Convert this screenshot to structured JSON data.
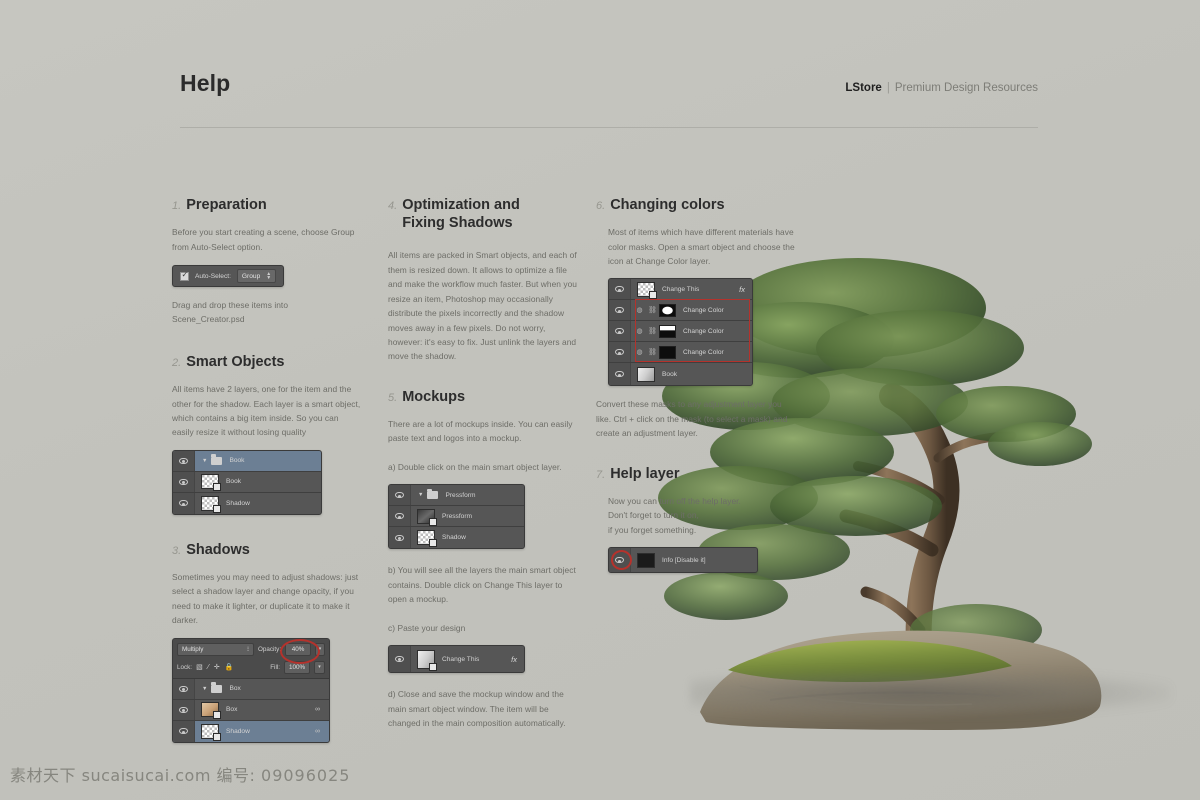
{
  "header": {
    "title": "Help",
    "brand_store": "LStore",
    "brand_separator": "|",
    "brand_tagline": "Premium Design Resources"
  },
  "columns": {
    "col1": [
      {
        "num": "1.",
        "title": "Preparation",
        "body": [
          "Before you start creating a scene, choose Group from Auto-Select option."
        ],
        "widget": {
          "type": "toolbar",
          "checkbox_label": "Auto-Select:",
          "select_value": "Group"
        },
        "body_after": [
          "Drag and drop these items into Scene_Creator.psd"
        ]
      },
      {
        "num": "2.",
        "title": "Smart Objects",
        "body": [
          "All items have 2 layers, one for the item and the other for the shadow. Each layer is a smart object, which contains a big item inside. So you can easily resize it without losing quality"
        ],
        "widget": {
          "type": "layers",
          "rows": [
            {
              "label": "Book",
              "kind": "group",
              "selected": true
            },
            {
              "label": "Book",
              "kind": "smart"
            },
            {
              "label": "Shadow",
              "kind": "smart"
            }
          ]
        }
      },
      {
        "num": "3.",
        "title": "Shadows",
        "body": [
          "Sometimes you may need to adjust shadows: just select a shadow layer and change opacity, if you need to make it lighter, or duplicate it to make it darker."
        ],
        "widget": {
          "type": "layers-full",
          "blend_mode": "Multiply",
          "opacity_label": "Opacity:",
          "opacity_value": "40%",
          "lock_label": "Lock:",
          "fill_label": "Fill:",
          "fill_value": "100%",
          "rows": [
            {
              "label": "Box",
              "kind": "group"
            },
            {
              "label": "Box",
              "kind": "image-box",
              "link": "∞"
            },
            {
              "label": "Shadow",
              "kind": "image-shadow",
              "link": "∞",
              "selected": true
            }
          ]
        }
      }
    ],
    "col2": [
      {
        "num": "4.",
        "title_line1": "Optimization and",
        "title_line2": "Fixing Shadows",
        "body": [
          "All items are packed in Smart objects, and each of them is resized down. It allows to optimize a file and make the workflow much faster. But when you resize an item, Photoshop may occasionally distribute the pixels incorrectly and the shadow moves away in a few pixels. Do not worry, however: it's easy to fix. Just unlink the layers and move the shadow."
        ]
      },
      {
        "num": "5.",
        "title": "Mockups",
        "body": [
          "There are a lot of mockups inside. You can easily paste text and logos into a mockup."
        ],
        "step_a": "a) Double click on the main smart object layer.",
        "widget_a": {
          "type": "layers",
          "rows": [
            {
              "label": "Pressform",
              "kind": "group"
            },
            {
              "label": "Pressform",
              "kind": "image-press"
            },
            {
              "label": "Shadow",
              "kind": "smart"
            }
          ]
        },
        "step_b": "b) You will see all the layers the main smart object contains. Double click on Change This layer to open a mockup.",
        "step_c": "c) Paste your design",
        "widget_c": {
          "type": "layers",
          "rows": [
            {
              "label": "Change This",
              "kind": "smart-fx",
              "fx": "fx"
            }
          ]
        },
        "step_d": "d) Close and save the mockup window and the main smart object window. The item will be changed in the main composition automatically."
      }
    ],
    "col3": [
      {
        "num": "6.",
        "title": "Changing colors",
        "body": [
          "Most of items which have different materials have color masks. Open a smart object and choose the icon at Change Color layer."
        ],
        "widget": {
          "type": "layers-masks",
          "rows": [
            {
              "label": "Change This",
              "kind": "smart-fx",
              "fx": "fx"
            },
            {
              "label": "Change Color",
              "kind": "mask",
              "mask_style": "m1",
              "boxed": true
            },
            {
              "label": "Change Color",
              "kind": "mask",
              "mask_style": "m2",
              "boxed": true
            },
            {
              "label": "Change Color",
              "kind": "mask",
              "mask_style": "m3",
              "boxed": true
            },
            {
              "label": "Book",
              "kind": "image-moss"
            }
          ]
        },
        "body_after": [
          "Convert these masks to any adjustment layer you like. Ctrl + click on the mask (to select a mask) and create an adjustment layer."
        ]
      },
      {
        "num": "7.",
        "title": "Help layer",
        "body": [
          "Now you can turn off the help layer.",
          " Don't forget to turn it on,",
          "if you forget something."
        ],
        "widget": {
          "type": "layers",
          "rows": [
            {
              "label": "Info [Disable it]",
              "kind": "info",
              "eye_highlight": true
            }
          ]
        }
      }
    ]
  },
  "watermark": {
    "site_cn": "素材天下",
    "site": "sucaisucai.com",
    "id_label": "编号:",
    "id_value": "09096025"
  },
  "colors": {
    "background": "#c3c3bd",
    "accent_red": "#b5322c",
    "panel": "#565656",
    "selected_row": "#6c7f94",
    "text": "#6d6d67",
    "heading": "#2d2d2d"
  }
}
